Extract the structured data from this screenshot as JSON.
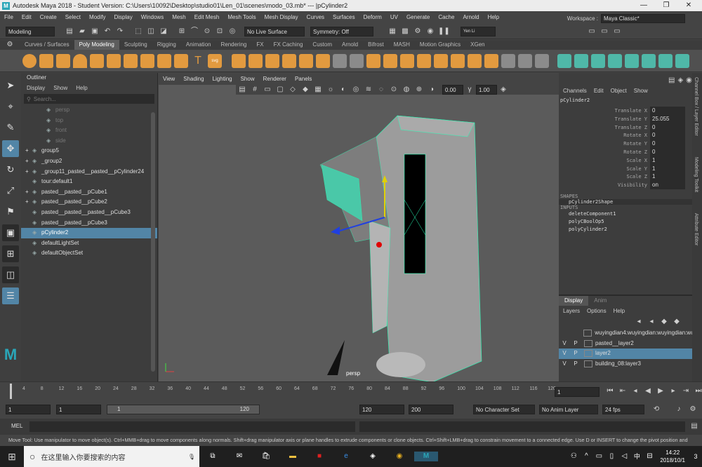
{
  "titlebar": {
    "logo": "M",
    "title": "Autodesk Maya 2018 - Student Version: C:\\Users\\10092\\Desktop\\studio01\\Len_01\\scenes\\modo_03.mb*   ---   |pCylinder2",
    "minimize": "—",
    "maximize": "❐",
    "close": "✕"
  },
  "menubar": {
    "items": [
      "File",
      "Edit",
      "Create",
      "Select",
      "Modify",
      "Display",
      "Windows",
      "Mesh",
      "Edit Mesh",
      "Mesh Tools",
      "Mesh Display",
      "Curves",
      "Surfaces",
      "Deform",
      "UV",
      "Generate",
      "Cache",
      "Arnold",
      "Help"
    ],
    "workspace_label": "Workspace :",
    "workspace_value": "Maya Classic*"
  },
  "statusline": {
    "mode": "Modeling",
    "live_surface": "No Live Surface",
    "symmetry": "Symmetry: Off",
    "user": "Yen Li"
  },
  "shelf": {
    "tabs": [
      "Curves / Surfaces",
      "Poly Modeling",
      "Sculpting",
      "Rigging",
      "Animation",
      "Rendering",
      "FX",
      "FX Caching",
      "Custom",
      "Arnold",
      "Bifrost",
      "MASH",
      "Motion Graphics",
      "XGen"
    ],
    "active": "Poly Modeling"
  },
  "outliner": {
    "title": "Outliner",
    "menu": [
      "Display",
      "Show",
      "Help"
    ],
    "search_placeholder": "Search...",
    "rows": [
      {
        "label": "persp",
        "state": "dim",
        "exp": ""
      },
      {
        "label": "top",
        "state": "dim",
        "exp": ""
      },
      {
        "label": "front",
        "state": "dim",
        "exp": ""
      },
      {
        "label": "side",
        "state": "dim",
        "exp": ""
      },
      {
        "label": "group5",
        "state": "",
        "exp": "+"
      },
      {
        "label": "_group2",
        "state": "",
        "exp": "+"
      },
      {
        "label": "_group11_pasted__pasted__pCylinder24",
        "state": "",
        "exp": "+"
      },
      {
        "label": "tour:default1",
        "state": "",
        "exp": ""
      },
      {
        "label": "pasted__pasted__pCube1",
        "state": "",
        "exp": "+"
      },
      {
        "label": "pasted__pasted__pCube2",
        "state": "",
        "exp": "+"
      },
      {
        "label": "pasted__pasted__pasted__pCube3",
        "state": "",
        "exp": ""
      },
      {
        "label": "pasted__pasted__pCube3",
        "state": "",
        "exp": ""
      },
      {
        "label": "pCylinder2",
        "state": "sel",
        "exp": ""
      },
      {
        "label": "defaultLightSet",
        "state": "",
        "exp": ""
      },
      {
        "label": "defaultObjectSet",
        "state": "",
        "exp": ""
      }
    ]
  },
  "viewport": {
    "menu": [
      "View",
      "Shading",
      "Lighting",
      "Show",
      "Renderer",
      "Panels"
    ],
    "exposure": "0.00",
    "gamma": "1.00",
    "camera_label": "persp"
  },
  "channelbox": {
    "menu": [
      "Channels",
      "Edit",
      "Object",
      "Show"
    ],
    "object": "pCylinder2",
    "attrs": [
      {
        "name": "Translate X",
        "value": "0"
      },
      {
        "name": "Translate Y",
        "value": "25.055"
      },
      {
        "name": "Translate Z",
        "value": "0"
      },
      {
        "name": "Rotate X",
        "value": "0"
      },
      {
        "name": "Rotate Y",
        "value": "0"
      },
      {
        "name": "Rotate Z",
        "value": "0"
      },
      {
        "name": "Scale X",
        "value": "1"
      },
      {
        "name": "Scale Y",
        "value": "1"
      },
      {
        "name": "Scale Z",
        "value": "1"
      },
      {
        "name": "Visibility",
        "value": "on"
      }
    ],
    "shapes_label": "SHAPES",
    "shape": "pCylinder2Shape",
    "inputs_label": "INPUTS",
    "inputs": [
      "deleteComponent1",
      "polyCBoolOp5",
      "polyCylinder2"
    ],
    "sidetabs": [
      "Channel Box / Layer Editor",
      "Modeling Toolkit",
      "Attribute Editor"
    ]
  },
  "layers": {
    "tabs": [
      "Display",
      "Anim"
    ],
    "menu": [
      "Layers",
      "Options",
      "Help"
    ],
    "rows": [
      {
        "v": "",
        "p": "",
        "name": "wuyingdian4:wuyingdian:wuyingdian:wu",
        "sel": false
      },
      {
        "v": "V",
        "p": "P",
        "name": "pasted__layer2",
        "sel": false
      },
      {
        "v": "V",
        "p": "P",
        "name": "layer2",
        "sel": true
      },
      {
        "v": "V",
        "p": "P",
        "name": "building_08:layer3",
        "sel": false
      }
    ]
  },
  "timeslider": {
    "ticks": [
      "4",
      "8",
      "12",
      "16",
      "20",
      "24",
      "28",
      "32",
      "36",
      "40",
      "44",
      "48",
      "52",
      "56",
      "60",
      "64",
      "68",
      "72",
      "76",
      "80",
      "84",
      "88",
      "92",
      "96",
      "100",
      "104",
      "108",
      "112",
      "116",
      "120"
    ],
    "current_frame": "1"
  },
  "range": {
    "start": "1",
    "playback_start": "1",
    "range_start": "1",
    "range_end": "120",
    "playback_end": "120",
    "end": "200",
    "character_set": "No Character Set",
    "anim_layer": "No Anim Layer",
    "fps": "24 fps"
  },
  "cmdline": {
    "label": "MEL"
  },
  "helpline": "Move Tool: Use manipulator to move object(s). Ctrl+MMB+drag to move components along normals. Shift+drag manipulator axis or plane handles to extrude components or clone objects. Ctrl+Shift+LMB+drag to constrain movement to a connected edge. Use D or INSERT to change the pivot position and",
  "taskbar": {
    "search_placeholder": "在这里输入你要搜索的内容",
    "time": "14:22",
    "date": "2018/10/1",
    "ime": "中",
    "notif": "3"
  }
}
